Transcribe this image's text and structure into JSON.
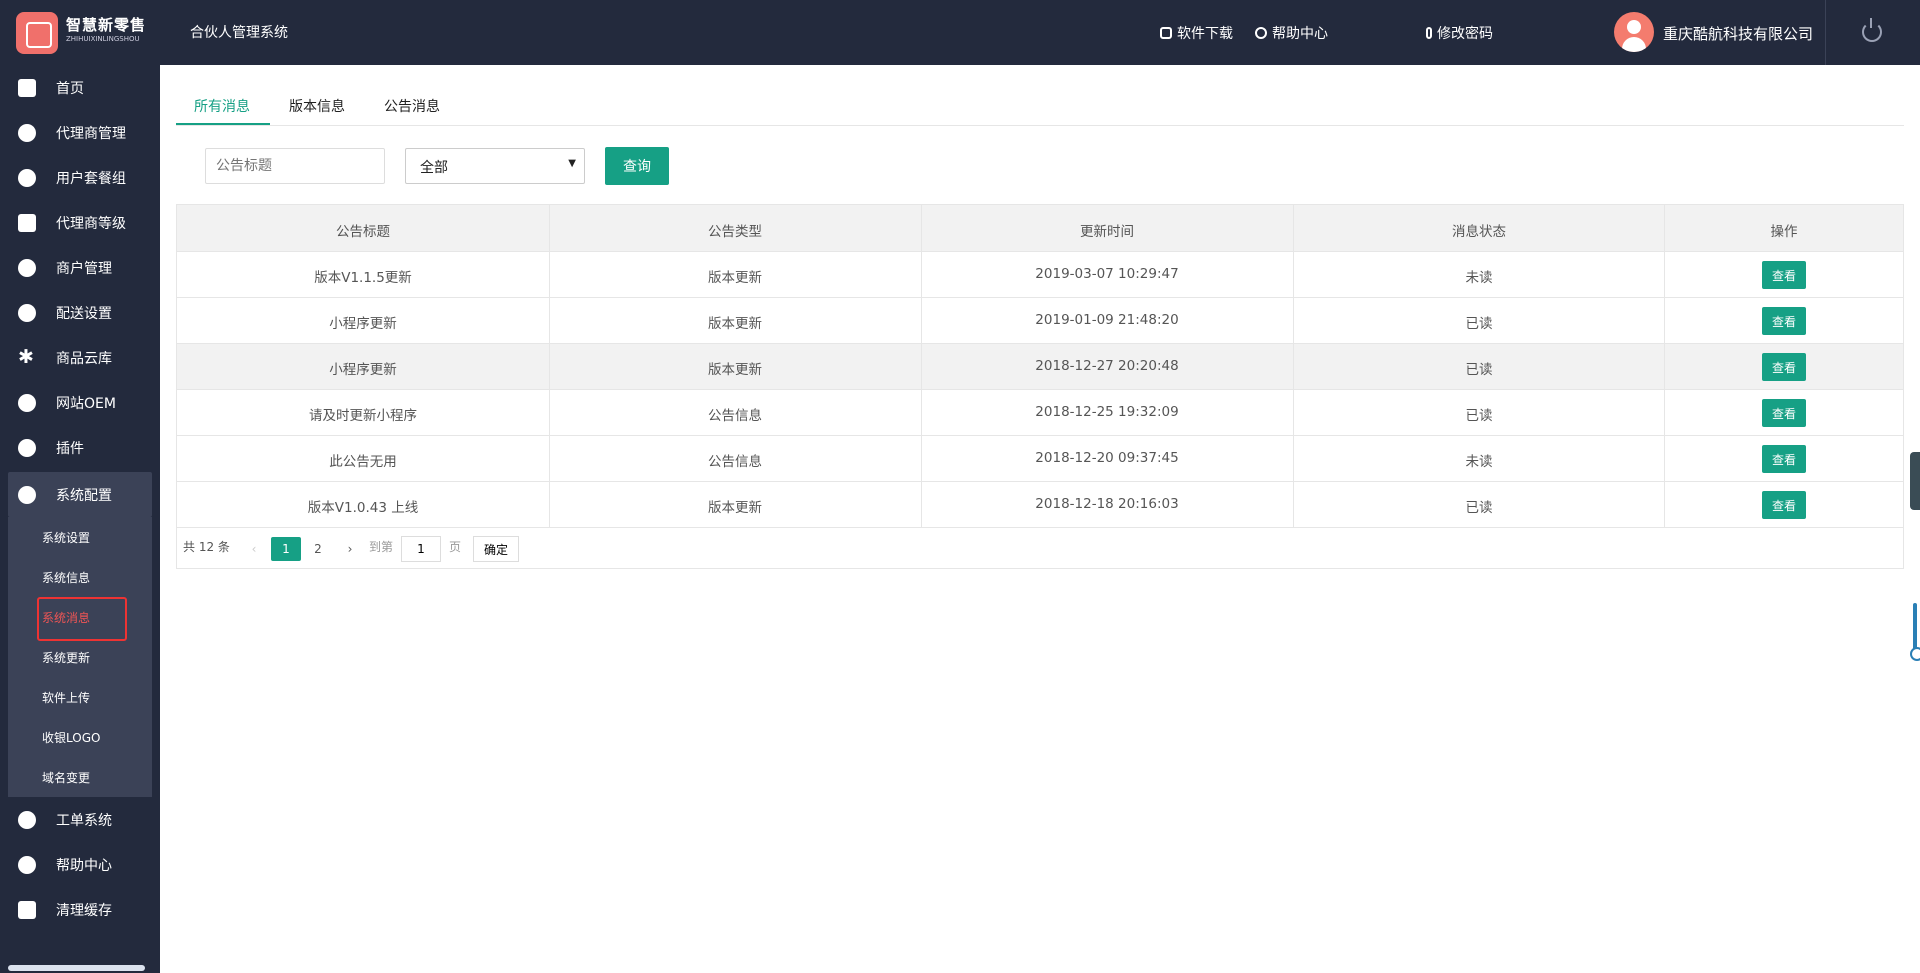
{
  "brand": {
    "name": "智慧新零售",
    "sub": "ZHIHUIXINLINGSHOU",
    "system": "合伙人管理系统"
  },
  "header": {
    "download": "软件下载",
    "help": "帮助中心",
    "password": "修改密码",
    "company": "重庆酷航科技有限公司"
  },
  "sidebar": {
    "items": [
      {
        "label": "首页",
        "icon": "home-icon"
      },
      {
        "label": "代理商管理",
        "icon": "agent-icon"
      },
      {
        "label": "用户套餐组",
        "icon": "package-icon"
      },
      {
        "label": "代理商等级",
        "icon": "level-icon"
      },
      {
        "label": "商户管理",
        "icon": "user-icon"
      },
      {
        "label": "配送设置",
        "icon": "delivery-icon"
      },
      {
        "label": "商品云库",
        "icon": "asterisk-icon"
      },
      {
        "label": "网站OEM",
        "icon": "send-icon"
      },
      {
        "label": "插件",
        "icon": "gear-icon"
      },
      {
        "label": "系统配置",
        "icon": "gears-icon"
      }
    ],
    "sub_items": [
      "系统设置",
      "系统信息",
      "系统消息",
      "系统更新",
      "软件上传",
      "收银LOGO",
      "域名变更"
    ],
    "bottom_items": [
      {
        "label": "工单系统",
        "icon": "send-icon"
      },
      {
        "label": "帮助中心",
        "icon": "question-icon"
      },
      {
        "label": "清理缓存",
        "icon": "trash-icon"
      }
    ]
  },
  "tabs": [
    "所有消息",
    "版本信息",
    "公告消息"
  ],
  "filter": {
    "placeholder": "公告标题",
    "select_value": "全部",
    "query": "查询"
  },
  "table": {
    "headers": [
      "公告标题",
      "公告类型",
      "更新时间",
      "消息状态",
      "操作"
    ],
    "rows": [
      {
        "title": "版本V1.1.5更新",
        "type": "版本更新",
        "time": "2019-03-07 10:29:47",
        "status": "未读",
        "action": "查看"
      },
      {
        "title": "小程序更新",
        "type": "版本更新",
        "time": "2019-01-09 21:48:20",
        "status": "已读",
        "action": "查看"
      },
      {
        "title": "小程序更新",
        "type": "版本更新",
        "time": "2018-12-27 20:20:48",
        "status": "已读",
        "action": "查看"
      },
      {
        "title": "请及时更新小程序",
        "type": "公告信息",
        "time": "2018-12-25 19:32:09",
        "status": "已读",
        "action": "查看"
      },
      {
        "title": "此公告无用",
        "type": "公告信息",
        "time": "2018-12-20 09:37:45",
        "status": "未读",
        "action": "查看"
      },
      {
        "title": "版本V1.0.43 上线",
        "type": "版本更新",
        "time": "2018-12-18 20:16:03",
        "status": "已读",
        "action": "查看"
      }
    ]
  },
  "pager": {
    "total": "共 12 条",
    "prev": "‹",
    "page1": "1",
    "page2": "2",
    "next": "›",
    "goto": "到第",
    "page_input": "1",
    "page_unit": "页",
    "confirm": "确定"
  },
  "colors": {
    "accent": "#16a085",
    "nav_bg": "#232a3d",
    "highlight": "#e33333"
  }
}
